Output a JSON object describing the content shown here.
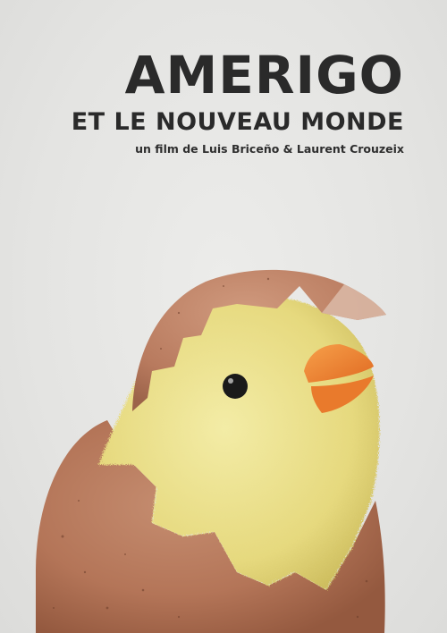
{
  "poster": {
    "title": "AMERIGO",
    "subtitle": "ET LE NOUVEAU MONDE",
    "credit": "un film de Luis Briceño & Laurent Crouzeix"
  },
  "illustration": {
    "subject": "chick-hatching-from-egg-icon",
    "colors": {
      "background": "#e6e6e4",
      "shell": "#b87a5e",
      "shell_inner": "#d9b7a4",
      "chick": "#eadf8c",
      "beak": "#f08a38",
      "eye": "#1a1a1a"
    }
  }
}
